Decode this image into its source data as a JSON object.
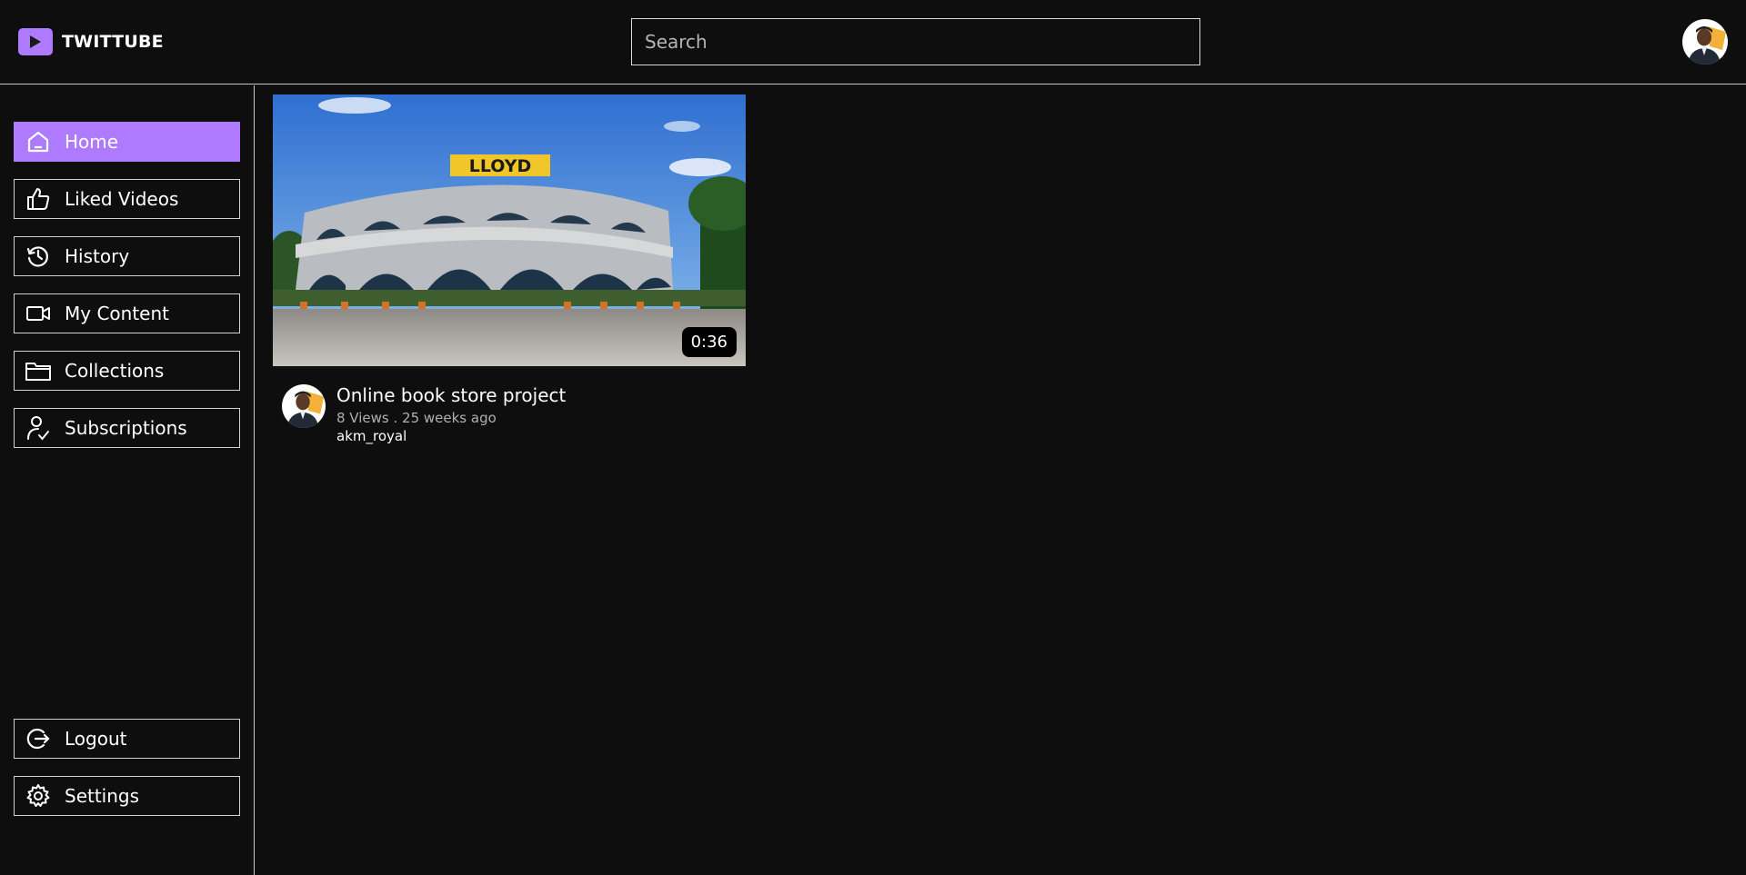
{
  "brand": {
    "name": "TWITTUBE",
    "accent": "#ae7aff"
  },
  "search": {
    "placeholder": "Search",
    "value": ""
  },
  "sidebar": {
    "items": [
      {
        "label": "Home",
        "icon": "home-icon",
        "active": true
      },
      {
        "label": "Liked Videos",
        "icon": "thumbs-up-icon"
      },
      {
        "label": "History",
        "icon": "history-icon"
      },
      {
        "label": "My Content",
        "icon": "video-camera-icon"
      },
      {
        "label": "Collections",
        "icon": "folder-icon"
      },
      {
        "label": "Subscriptions",
        "icon": "user-check-icon"
      }
    ],
    "bottom": [
      {
        "label": "Logout",
        "icon": "logout-icon"
      },
      {
        "label": "Settings",
        "icon": "gear-icon"
      }
    ]
  },
  "videos": [
    {
      "title": "Online book store project",
      "stats": "8 Views . 25 weeks ago",
      "channel": "akm_royal",
      "duration": "0:36",
      "thumbnail_sign": "LLOYD"
    }
  ]
}
